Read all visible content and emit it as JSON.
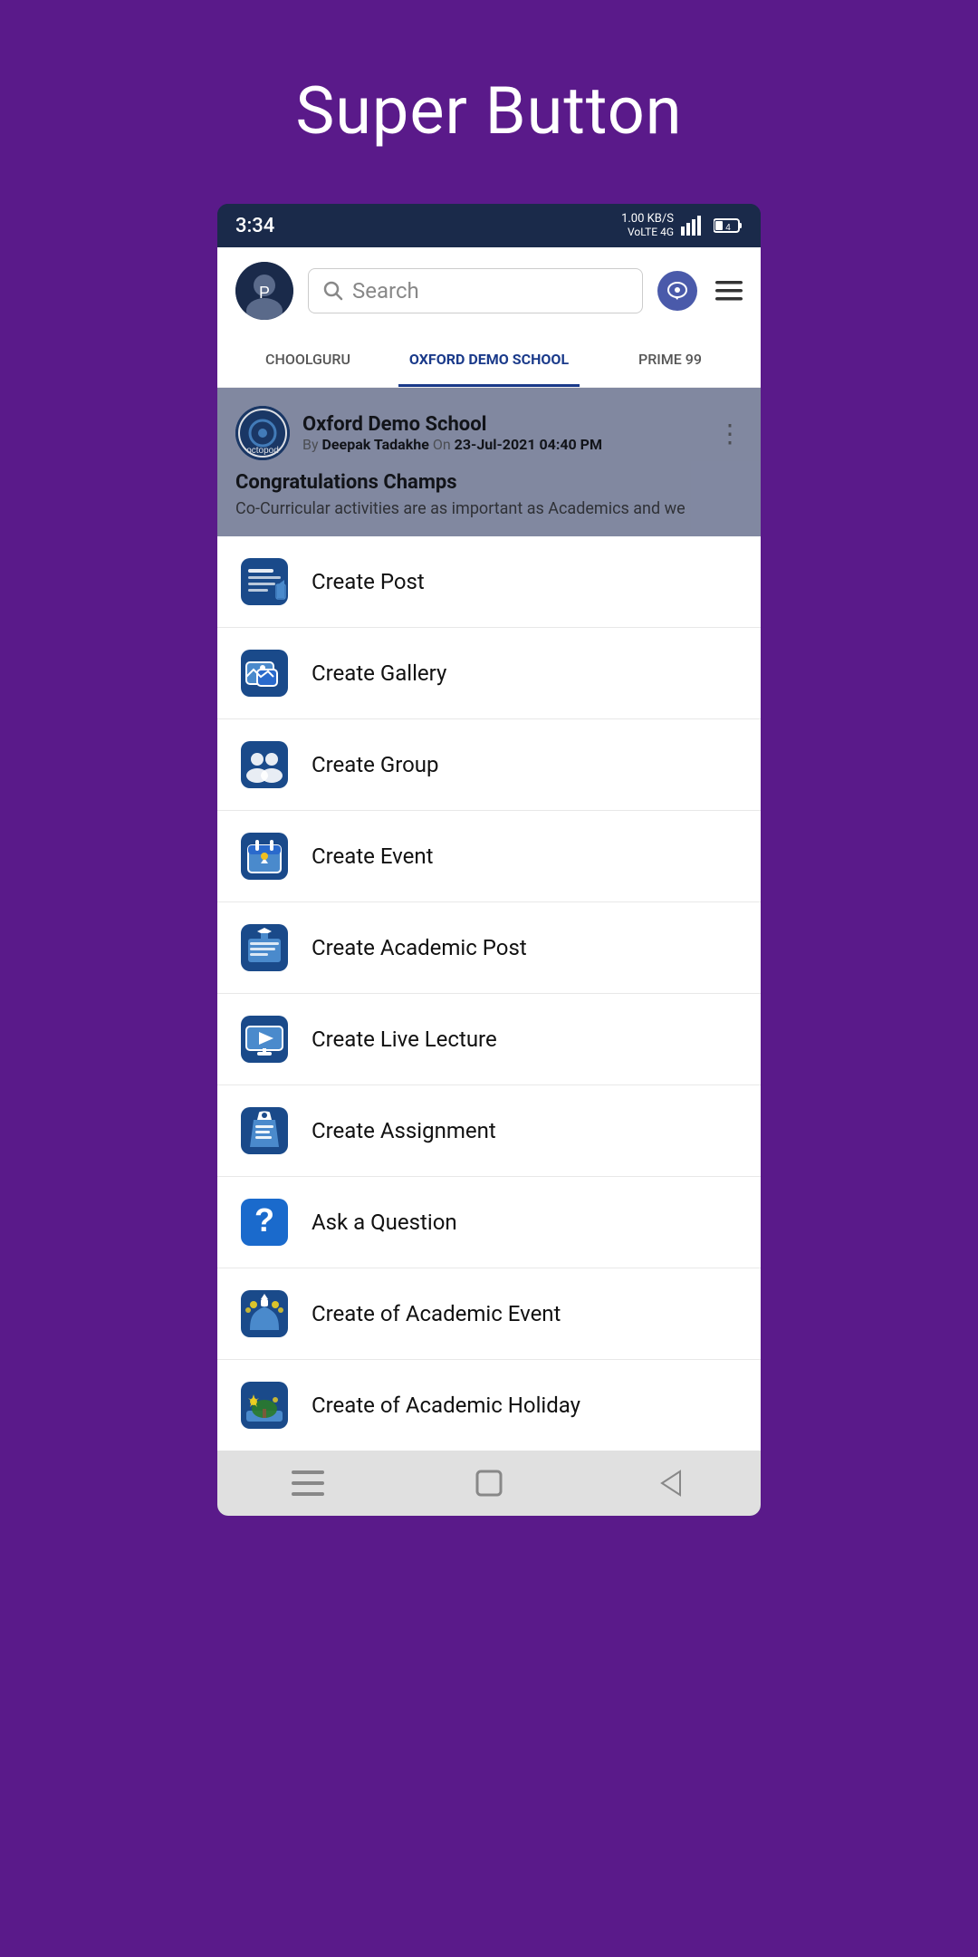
{
  "page": {
    "title": "Super Button",
    "background_color": "#5a1a8a"
  },
  "status_bar": {
    "time": "3:34",
    "network_info": "1.00 KB/S",
    "network_type": "VoLTE 4G",
    "signal": "||||",
    "battery": "4"
  },
  "header": {
    "search_placeholder": "Search",
    "search_text": "Search"
  },
  "tabs": [
    {
      "label": "CHOOLGURU",
      "active": false
    },
    {
      "label": "OXFORD DEMO SCHOOL",
      "active": true
    },
    {
      "label": "PRIME 99",
      "active": false
    }
  ],
  "post": {
    "school_name": "Oxford Demo School",
    "author": "Deepak Tadakhe",
    "date": "23-Jul-2021 04:40 PM",
    "title": "Congratulations Champs",
    "body": "Co-Curricular activities are as important as Academics and we"
  },
  "menu_items": [
    {
      "id": "create-post",
      "label": "Create Post",
      "icon": "post"
    },
    {
      "id": "create-gallery",
      "label": "Create Gallery",
      "icon": "gallery"
    },
    {
      "id": "create-group",
      "label": "Create Group",
      "icon": "group"
    },
    {
      "id": "create-event",
      "label": "Create Event",
      "icon": "event"
    },
    {
      "id": "create-academic-post",
      "label": "Create Academic Post",
      "icon": "academic-post"
    },
    {
      "id": "create-live-lecture",
      "label": "Create Live Lecture",
      "icon": "live-lecture"
    },
    {
      "id": "create-assignment",
      "label": "Create Assignment",
      "icon": "assignment"
    },
    {
      "id": "ask-question",
      "label": "Ask a Question",
      "icon": "question"
    },
    {
      "id": "create-academic-event",
      "label": "Create of Academic Event",
      "icon": "academic-event"
    },
    {
      "id": "create-academic-holiday",
      "label": "Create of Academic Holiday",
      "icon": "academic-holiday"
    }
  ],
  "bottom_nav": {
    "menu_icon": "☰",
    "square_icon": "□",
    "back_icon": "◁"
  }
}
